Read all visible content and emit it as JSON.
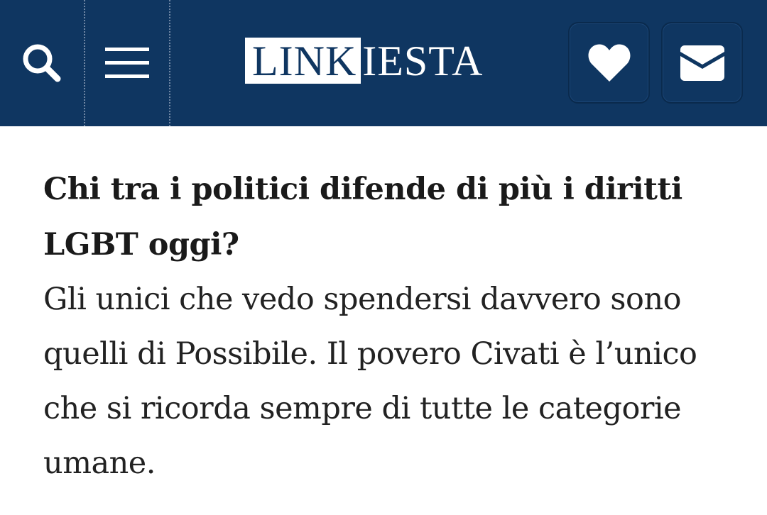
{
  "header": {
    "logo": {
      "part1": "LINK",
      "part2": "IESTA"
    },
    "icons": {
      "search": "search-icon",
      "menu": "hamburger-menu-icon",
      "favorite": "heart-icon",
      "newsletter": "envelope-icon"
    },
    "colors": {
      "background": "#0f3661",
      "icon": "#ffffff"
    }
  },
  "article": {
    "question": "Chi tra i politici difende di più i diritti LGBT oggi?",
    "answer": "Gli unici che vedo spendersi davvero sono quelli di Possibile. Il povero Civati è l’unico che si ricorda sempre di tutte le categorie umane."
  }
}
